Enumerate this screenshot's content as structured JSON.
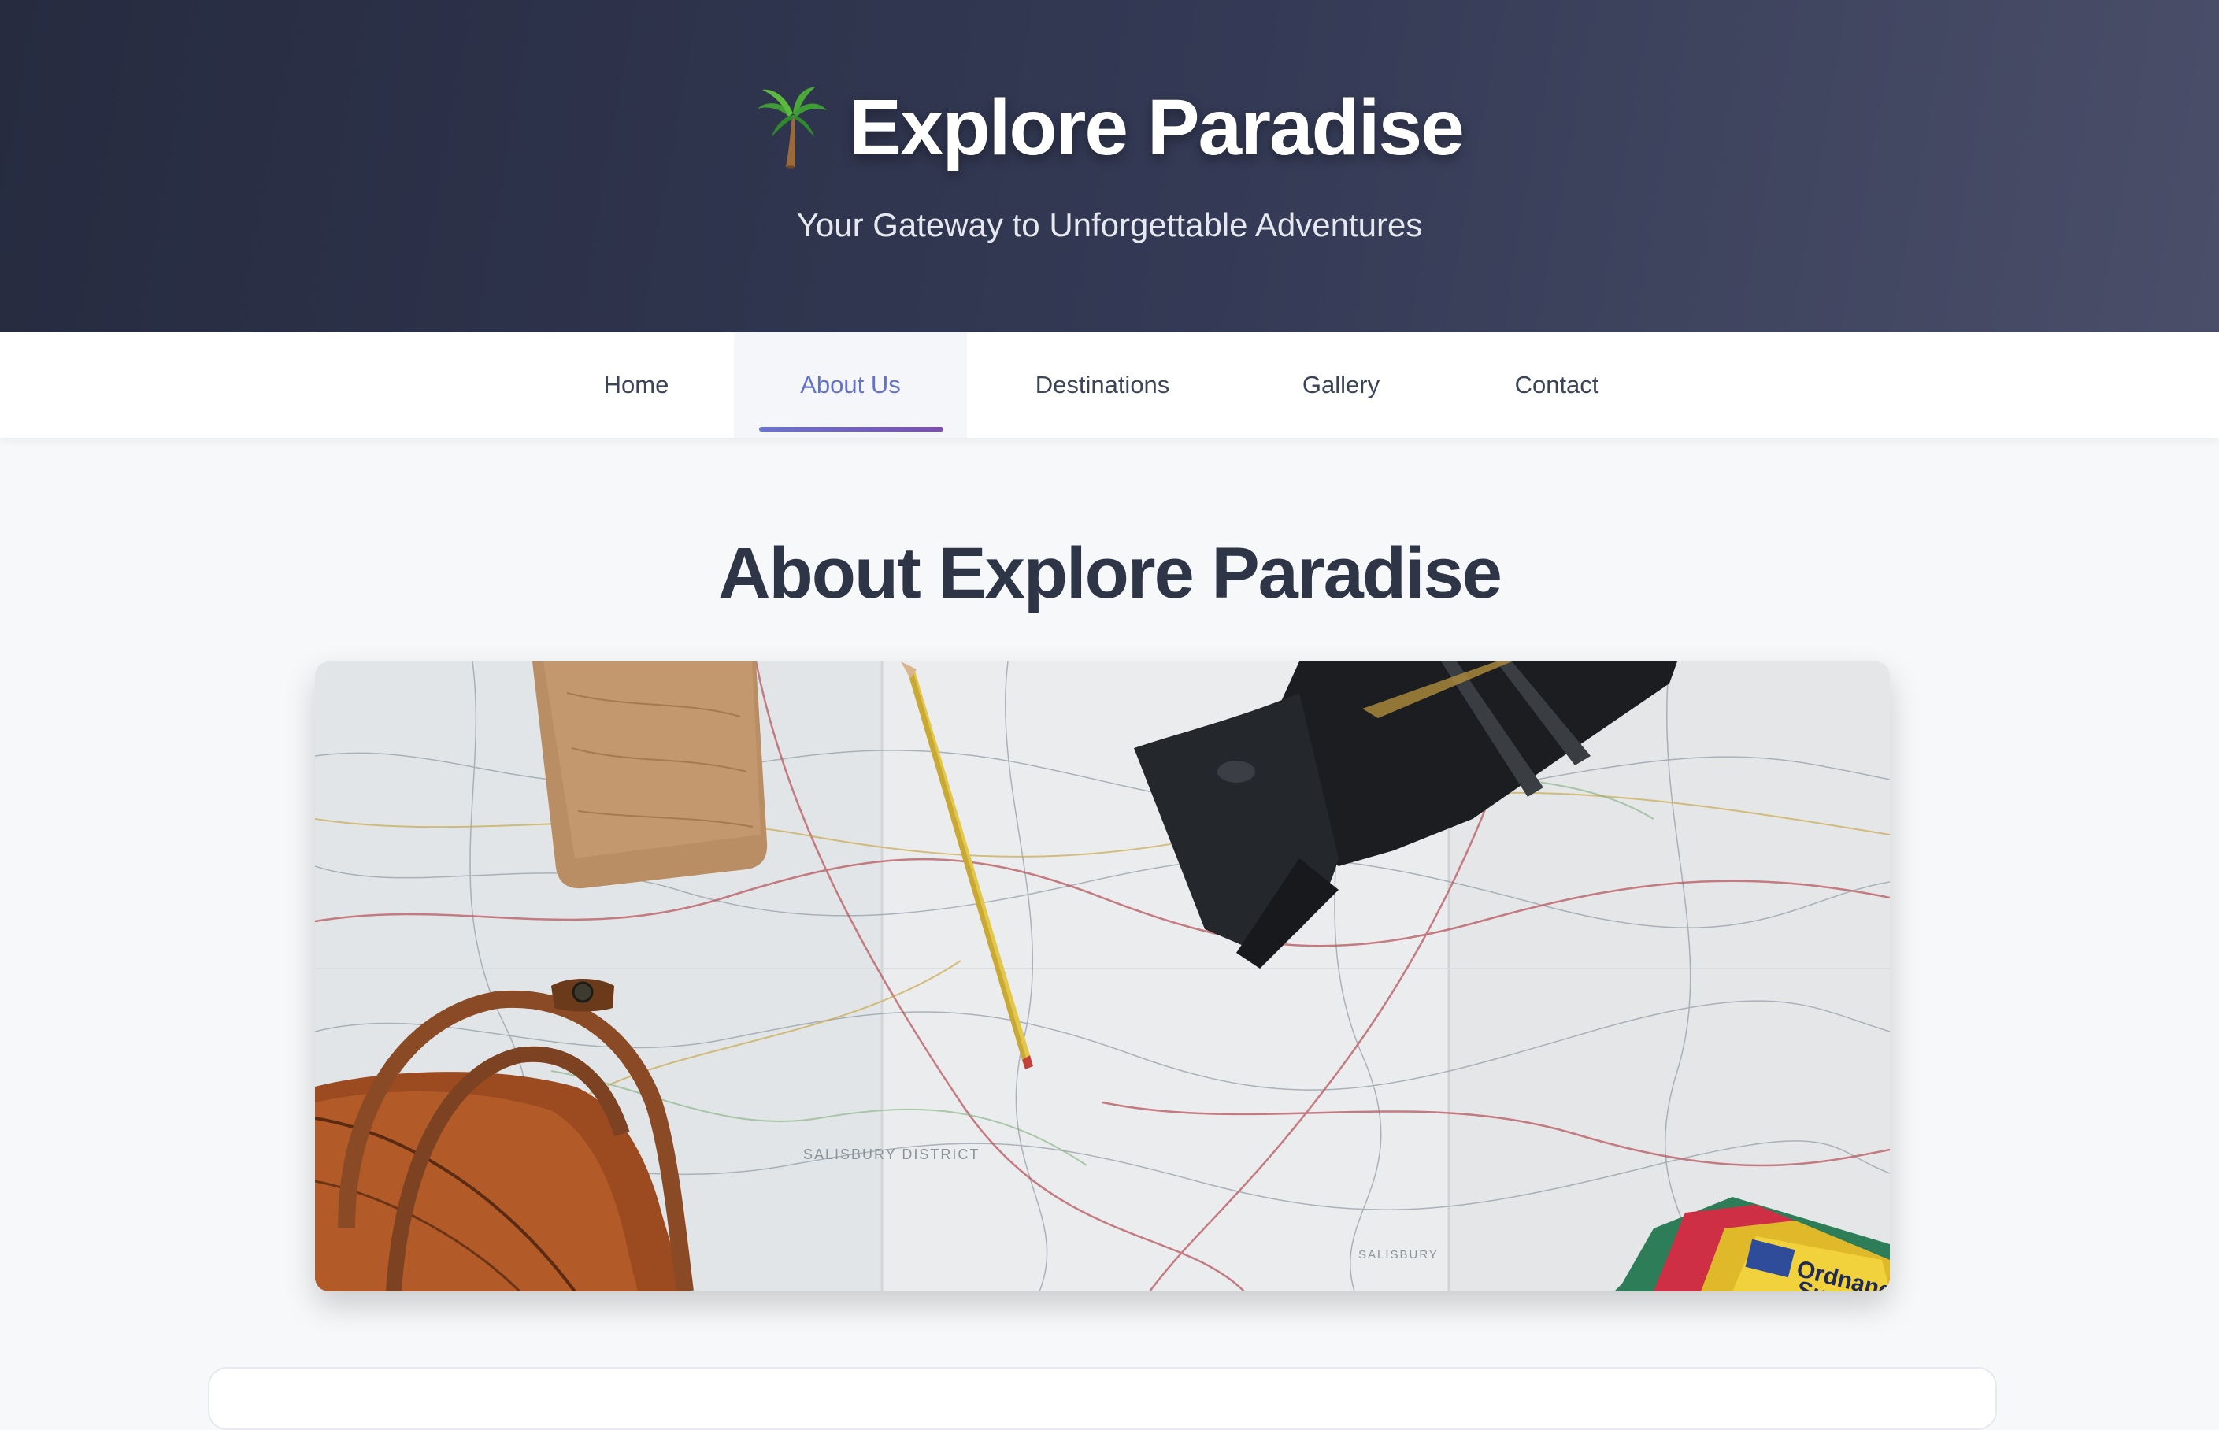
{
  "header": {
    "icon": "palm-tree-icon",
    "title": "Explore Paradise",
    "subtitle": "Your Gateway to Unforgettable Adventures"
  },
  "nav": {
    "items": [
      {
        "label": "Home",
        "active": false
      },
      {
        "label": "About Us",
        "active": true
      },
      {
        "label": "Destinations",
        "active": false
      },
      {
        "label": "Gallery",
        "active": false
      },
      {
        "label": "Contact",
        "active": false
      }
    ]
  },
  "main": {
    "heading": "About Explore Paradise",
    "image": {
      "map_labels": [
        "SALISBURY DISTRICT",
        "SALISBURY"
      ],
      "product_text": [
        "Ordnance",
        "Survey"
      ]
    }
  },
  "colors": {
    "hero_dark": "#262b40",
    "accent": "#6472c9",
    "underline_end": "#7b4fae",
    "text": "#2d3546"
  }
}
